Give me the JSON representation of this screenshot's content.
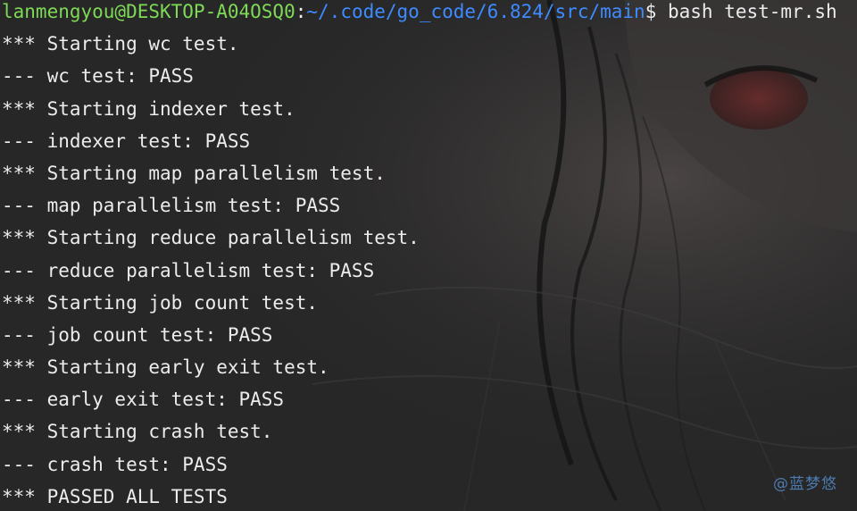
{
  "prompt": {
    "user_host": "lanmengyou@DESKTOP-A04OSQ0",
    "separator": ":",
    "path": "~/.code/go_code/6.824/src/main",
    "symbol": "$",
    "command": " bash test-mr.sh"
  },
  "output_lines": [
    "*** Starting wc test.",
    "--- wc test: PASS",
    "*** Starting indexer test.",
    "--- indexer test: PASS",
    "*** Starting map parallelism test.",
    "--- map parallelism test: PASS",
    "*** Starting reduce parallelism test.",
    "--- reduce parallelism test: PASS",
    "*** Starting job count test.",
    "--- job count test: PASS",
    "*** Starting early exit test.",
    "--- early exit test: PASS",
    "*** Starting crash test.",
    "--- crash test: PASS",
    "*** PASSED ALL TESTS"
  ],
  "watermark": "@蓝梦悠",
  "colors": {
    "background": "#272727",
    "text": "#ececec",
    "user_host": "#7ed957",
    "path": "#3e8bff",
    "watermark": "#4d7bb0"
  }
}
